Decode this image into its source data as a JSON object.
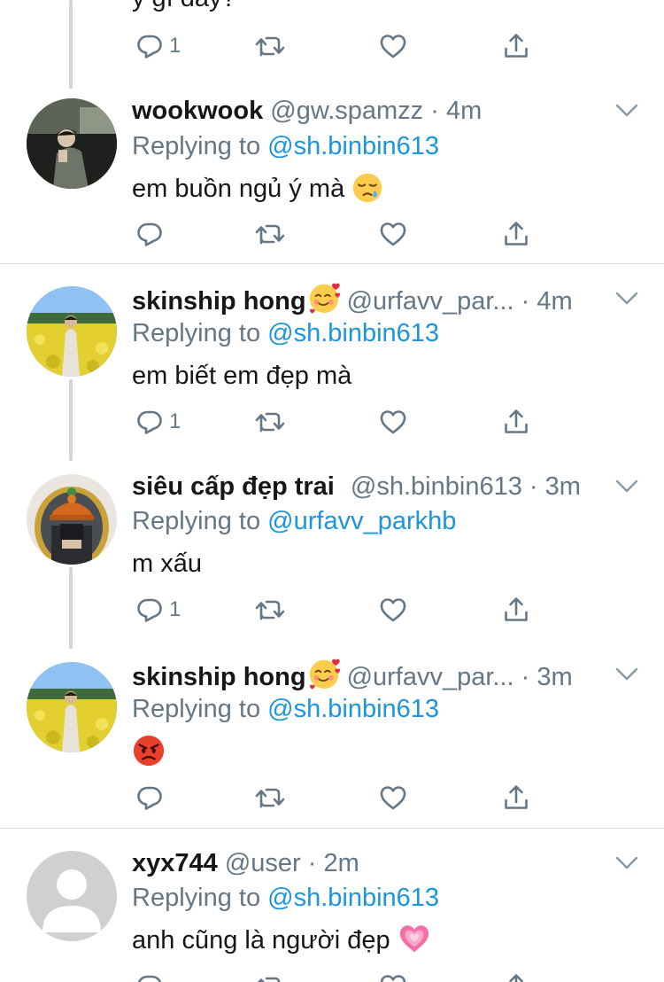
{
  "top_fragment": "ý gì đây?",
  "tweets": [
    {
      "display_name": "",
      "handle_time": "",
      "reply_count": "1"
    },
    {
      "display_name": "wookwook",
      "handle_time": "@gw.spamzz · 4m",
      "replying_prefix": "Replying to ",
      "replying_to": "@sh.binbin613",
      "text": "em buồn ngủ ý mà",
      "reply_count": ""
    },
    {
      "display_name": "skinship hong",
      "handle_time": "@urfavv_par... · 4m",
      "replying_prefix": "Replying to ",
      "replying_to": "@sh.binbin613",
      "text": "em biết em đẹp mà",
      "reply_count": "1"
    },
    {
      "display_name": "siêu cấp đẹp trai",
      "handle_time": "@sh.binbin613 · 3m",
      "replying_prefix": "Replying to ",
      "replying_to": "@urfavv_parkhb",
      "text": "m xấu",
      "reply_count": "1"
    },
    {
      "display_name": "skinship hong",
      "handle_time": "@urfavv_par... · 3m",
      "replying_prefix": "Replying to ",
      "replying_to": "@sh.binbin613",
      "text": "",
      "reply_count": ""
    },
    {
      "display_name": "xyx744",
      "handle_time": "@user · 2m",
      "replying_prefix": "Replying to ",
      "replying_to": "@sh.binbin613",
      "text": "anh cũng là người đẹp"
    }
  ],
  "icons": {
    "reply": "reply-icon",
    "retweet": "retweet-icon",
    "like": "heart-icon",
    "share": "share-icon",
    "more": "chevron-down-icon"
  },
  "colors": {
    "mention": "#1b95e0",
    "secondary_text": "#657786",
    "icon": "#657786",
    "divider": "#d6dce1",
    "thread_line": "#ccd6dd"
  }
}
